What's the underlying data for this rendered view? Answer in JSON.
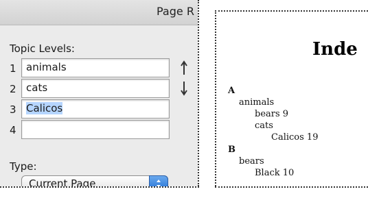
{
  "panel": {
    "header_title": "Page R",
    "topic_levels_label": "Topic Levels:",
    "topics": [
      {
        "num": "1",
        "value": "animals"
      },
      {
        "num": "2",
        "value": "cats"
      },
      {
        "num": "3",
        "value": "Calicos"
      },
      {
        "num": "4",
        "value": ""
      }
    ],
    "type_label": "Type:",
    "type_value": "Current Page"
  },
  "preview": {
    "title": "Inde",
    "entries": [
      {
        "text": "A",
        "bold": true
      },
      {
        "text": "animals"
      },
      {
        "text": "bears  9"
      },
      {
        "text": "cats"
      },
      {
        "text": "Calicos  19"
      },
      {
        "text": "B",
        "bold": true
      },
      {
        "text": "bears"
      },
      {
        "text": "Black  10"
      }
    ]
  },
  "colors": {
    "selection": "#b5d5ff",
    "stepper_blue": "#1f6fd4"
  }
}
